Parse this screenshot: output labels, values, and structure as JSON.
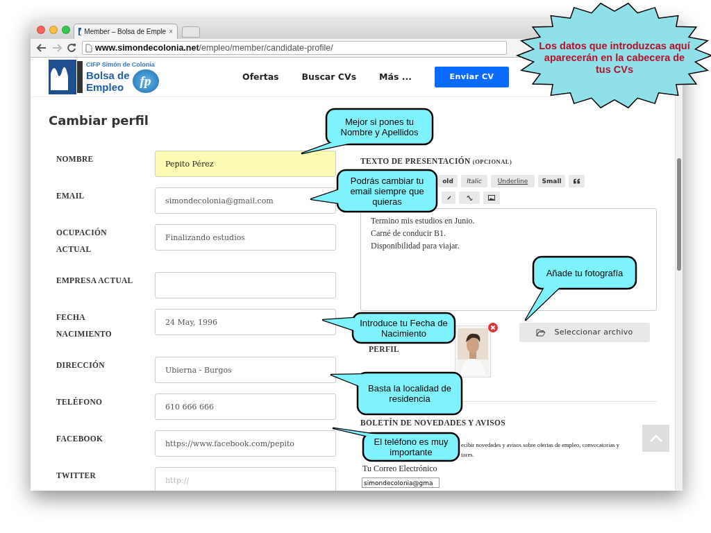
{
  "browser": {
    "tab_title": "Member – Bolsa de Emple",
    "tab_close": "×",
    "url_host": "www.simondecolonia.net",
    "url_path": "/empleo/member/candidate-profile/"
  },
  "site": {
    "logo": {
      "org": "CIFP Simón de Colonia",
      "title_line1": "Bolsa de",
      "title_line2": "Empleo",
      "badge": "fp"
    },
    "nav": [
      {
        "label": "Ofertas"
      },
      {
        "label": "Buscar CVs"
      },
      {
        "label": "Más ..."
      }
    ],
    "cta": "Enviar CV"
  },
  "page_title": "Cambiar perfil",
  "fields": [
    {
      "label": "NOMBRE",
      "value": "Pepito Pérez",
      "autofilled": true
    },
    {
      "label": "EMAIL",
      "value": "simondecolonia@gmail.com",
      "autofilled": false
    },
    {
      "label": "OCUPACIÓN ACTUAL",
      "value": "Finalizando estudios",
      "autofilled": false
    },
    {
      "label": "EMPRESA ACTUAL",
      "autofilled": false
    },
    {
      "label": "FECHA NACIMIENTO",
      "value": "24 May, 1996",
      "autofilled": false
    },
    {
      "label": "DIRECCIÓN",
      "value": "Ubierna - Burgos",
      "autofilled": false
    },
    {
      "label": "TELÉFONO",
      "value": "610 666 666",
      "autofilled": false
    },
    {
      "label": "FACEBOOK",
      "value": "https://www.facebook.com/pepito",
      "autofilled": false
    },
    {
      "label": "TWITTER",
      "placeholder": "http://",
      "autofilled": false
    }
  ],
  "presentation": {
    "heading": "TEXTO DE PRESENTACIÓN",
    "note": "(OPCIONAL)",
    "toolbar_rows": [
      [
        {
          "kind": "bold",
          "label": "old"
        },
        {
          "kind": "italic",
          "label": "Italic"
        },
        {
          "kind": "underline",
          "label": "Underline"
        },
        {
          "kind": "small",
          "label": "Small"
        },
        {
          "kind": "icon"
        }
      ],
      [
        {
          "kind": "icon"
        },
        {
          "kind": "icon"
        },
        {
          "kind": "icon"
        }
      ]
    ],
    "lines": [
      "Termino mis estudios en Junio.",
      "Carné de conducir B1.",
      "Disponibilidad para viajar."
    ]
  },
  "photo": {
    "label": "PERFIL",
    "file_button": "Seleccionar archivo"
  },
  "newsletter": {
    "heading": "BOLETÍN DE NOVEDADES Y AVISOS",
    "text_fragments": [
      "ecibir novedades y avisos sobre ofertas de empleo, convocatorias y",
      "tores."
    ],
    "email_label": "Tu Correo Electrónico",
    "email_value": "simondecolonia@gma"
  },
  "callouts": [
    {
      "kind": "starburst",
      "text": "Los datos que introduzcas aquí aparecerán en la cabecera de tus CVs"
    },
    {
      "kind": "speech",
      "text": "Mejor si pones tu Nombre y Apellidos"
    },
    {
      "kind": "speech",
      "text": "Podrás cambiar tu email siempre que quieras"
    },
    {
      "kind": "speech",
      "text": "Añade tu fotografía"
    },
    {
      "kind": "speech",
      "text": "Introduce tu Fecha de Nacimiento"
    },
    {
      "kind": "speech",
      "text": "Basta la localidad de residencia"
    },
    {
      "kind": "speech",
      "text": "El teléfono es muy importante"
    }
  ]
}
